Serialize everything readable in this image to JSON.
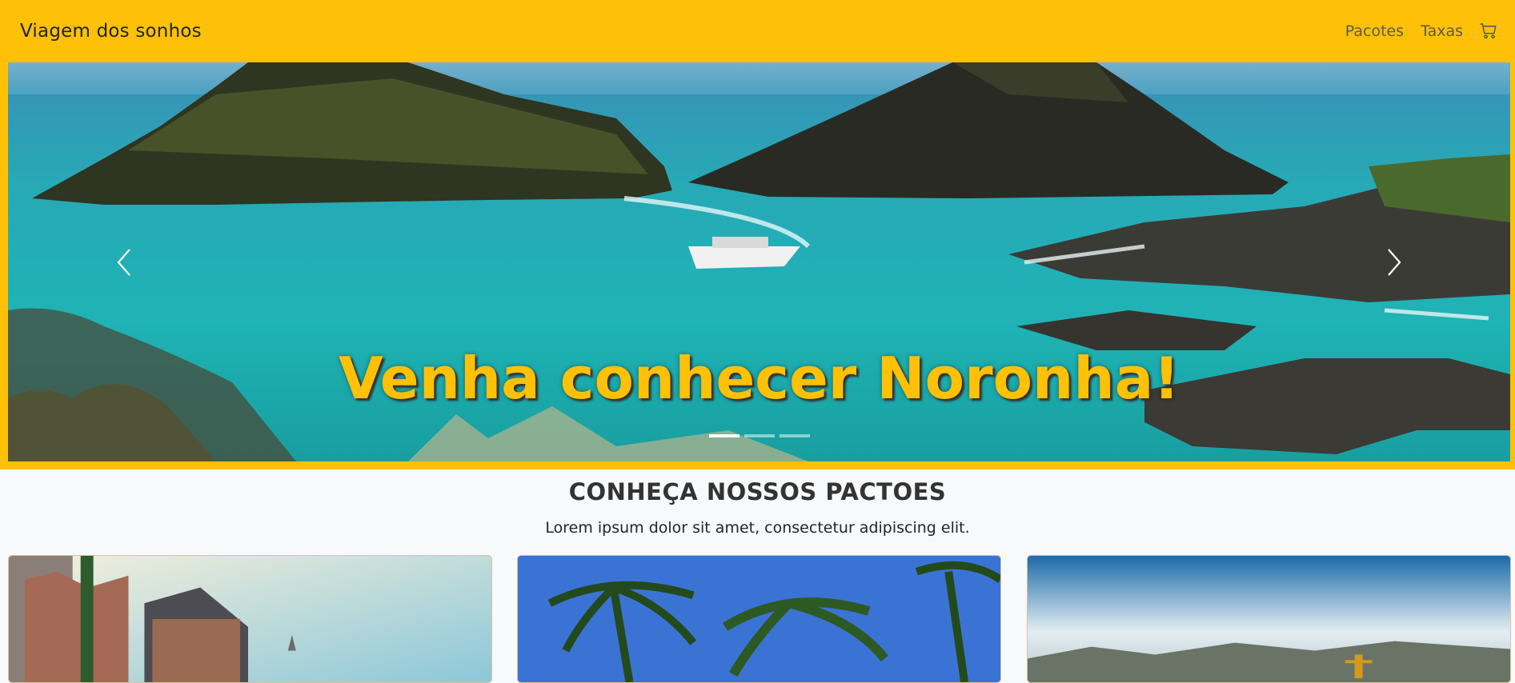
{
  "navbar": {
    "brand": "Viagem dos sonhos",
    "links": [
      {
        "label": "Pacotes"
      },
      {
        "label": "Taxas"
      }
    ],
    "cart_icon": "cart-icon"
  },
  "hero": {
    "caption": "Venha conhecer Noronha!",
    "prev_icon": "chevron-left-icon",
    "next_icon": "chevron-right-icon",
    "slide_count": 3,
    "active_slide": 1
  },
  "section": {
    "title": "CONHEÇA NOSSOS PACTOES",
    "subtitle": "Lorem ipsum dolor sit amet, consectetur adipiscing elit."
  },
  "colors": {
    "accent": "#ffc107",
    "page_background": "#f8f9fa"
  }
}
